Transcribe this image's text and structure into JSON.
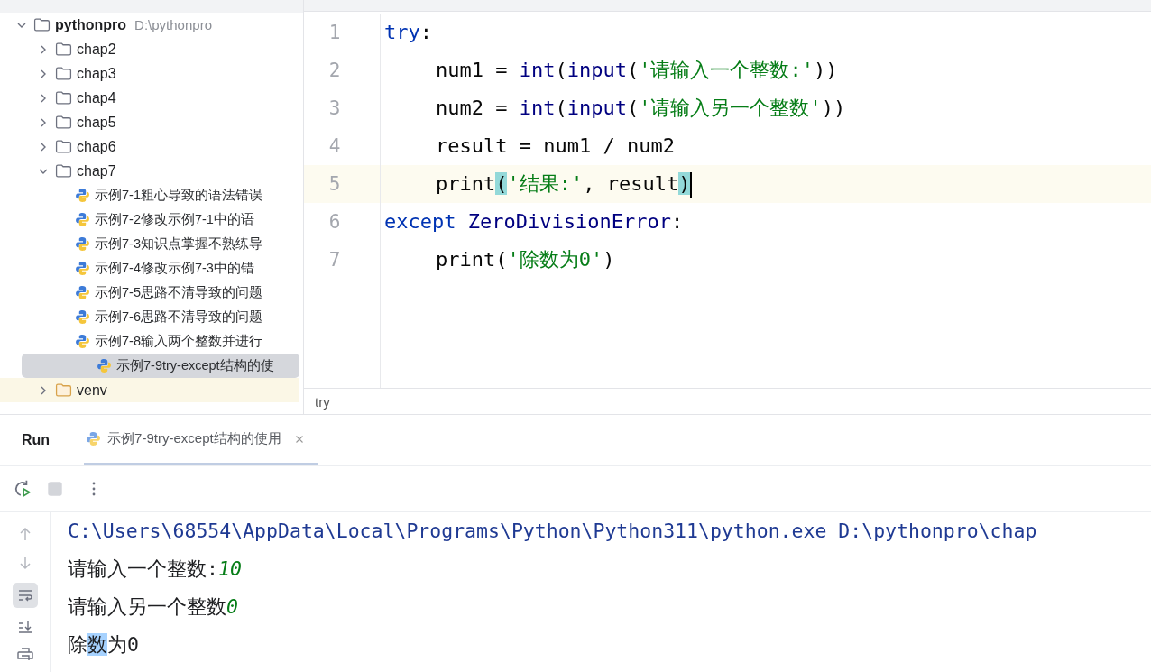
{
  "project_tree": {
    "root": {
      "label": "pythonpro",
      "path": "D:\\pythonpro",
      "expanded": true,
      "children": [
        {
          "kind": "folder",
          "label": "chap2",
          "expanded": false
        },
        {
          "kind": "folder",
          "label": "chap3",
          "expanded": false
        },
        {
          "kind": "folder",
          "label": "chap4",
          "expanded": false
        },
        {
          "kind": "folder",
          "label": "chap5",
          "expanded": false
        },
        {
          "kind": "folder",
          "label": "chap6",
          "expanded": false
        },
        {
          "kind": "folder",
          "label": "chap7",
          "expanded": true,
          "children": [
            {
              "kind": "python-file",
              "label": "示例7-1粗心导致的语法错误",
              "selected": false
            },
            {
              "kind": "python-file",
              "label": "示例7-2修改示例7-1中的语",
              "selected": false
            },
            {
              "kind": "python-file",
              "label": "示例7-3知识点掌握不熟练导",
              "selected": false
            },
            {
              "kind": "python-file",
              "label": "示例7-4修改示例7-3中的错",
              "selected": false
            },
            {
              "kind": "python-file",
              "label": "示例7-5思路不清导致的问题",
              "selected": false
            },
            {
              "kind": "python-file",
              "label": "示例7-6思路不清导致的问题",
              "selected": false
            },
            {
              "kind": "python-file",
              "label": "示例7-8输入两个整数并进行",
              "selected": false
            },
            {
              "kind": "python-file",
              "label": "示例7-9try-except结构的使",
              "selected": true
            }
          ]
        },
        {
          "kind": "excluded-folder",
          "label": "venv",
          "expanded": false
        }
      ]
    }
  },
  "editor": {
    "lines": [
      {
        "number": "1",
        "indented": false,
        "current": false,
        "caret": false,
        "tokens": [
          {
            "kind": "keyword",
            "text": "try"
          },
          {
            "kind": "plain",
            "text": ":"
          }
        ]
      },
      {
        "number": "2",
        "indented": true,
        "current": false,
        "caret": false,
        "tokens": [
          {
            "kind": "plain",
            "text": "num1 = "
          },
          {
            "kind": "builtin",
            "text": "int"
          },
          {
            "kind": "plain",
            "text": "("
          },
          {
            "kind": "builtin",
            "text": "input"
          },
          {
            "kind": "plain",
            "text": "("
          },
          {
            "kind": "string",
            "text": "'请输入一个整数:'"
          },
          {
            "kind": "plain",
            "text": "))"
          }
        ]
      },
      {
        "number": "3",
        "indented": true,
        "current": false,
        "caret": false,
        "tokens": [
          {
            "kind": "plain",
            "text": "num2 = "
          },
          {
            "kind": "builtin",
            "text": "int"
          },
          {
            "kind": "plain",
            "text": "("
          },
          {
            "kind": "builtin",
            "text": "input"
          },
          {
            "kind": "plain",
            "text": "("
          },
          {
            "kind": "string",
            "text": "'请输入另一个整数'"
          },
          {
            "kind": "plain",
            "text": "))"
          }
        ]
      },
      {
        "number": "4",
        "indented": true,
        "current": false,
        "caret": false,
        "tokens": [
          {
            "kind": "plain",
            "text": "result = num1 / num2"
          }
        ]
      },
      {
        "number": "5",
        "indented": true,
        "current": true,
        "caret": true,
        "tokens": [
          {
            "kind": "plain",
            "text": "print"
          },
          {
            "kind": "paren-match",
            "text": "("
          },
          {
            "kind": "string",
            "text": "'结果:'"
          },
          {
            "kind": "plain",
            "text": ", result"
          },
          {
            "kind": "paren-match",
            "text": ")"
          }
        ]
      },
      {
        "number": "6",
        "indented": false,
        "current": false,
        "caret": false,
        "tokens": [
          {
            "kind": "keyword",
            "text": "except "
          },
          {
            "kind": "builtin",
            "text": "ZeroDivisionError"
          },
          {
            "kind": "plain",
            "text": ":"
          }
        ]
      },
      {
        "number": "7",
        "indented": true,
        "current": false,
        "caret": false,
        "tokens": [
          {
            "kind": "plain",
            "text": "print("
          },
          {
            "kind": "string",
            "text": "'除数为0'"
          },
          {
            "kind": "plain",
            "text": ")"
          }
        ]
      }
    ],
    "breadcrumb": "try"
  },
  "run_panel": {
    "title": "Run",
    "tabs": [
      {
        "label": "示例7-9try-except结构的使用",
        "selected": true
      }
    ],
    "soft_wrap_on": true,
    "console": [
      {
        "segments": [
          {
            "kind": "command",
            "text": "C:\\Users\\68554\\AppData\\Local\\Programs\\Python\\Python311\\python.exe D:\\pythonpro\\chap"
          }
        ]
      },
      {
        "segments": [
          {
            "kind": "output",
            "text": "请输入一个整数:"
          },
          {
            "kind": "input",
            "text": "10"
          }
        ]
      },
      {
        "segments": [
          {
            "kind": "output",
            "text": "请输入另一个整数"
          },
          {
            "kind": "input",
            "text": "0"
          }
        ]
      },
      {
        "segments": [
          {
            "kind": "output",
            "text": "除"
          },
          {
            "kind": "highlight",
            "text": "数"
          },
          {
            "kind": "output",
            "text": "为0"
          }
        ]
      }
    ]
  }
}
